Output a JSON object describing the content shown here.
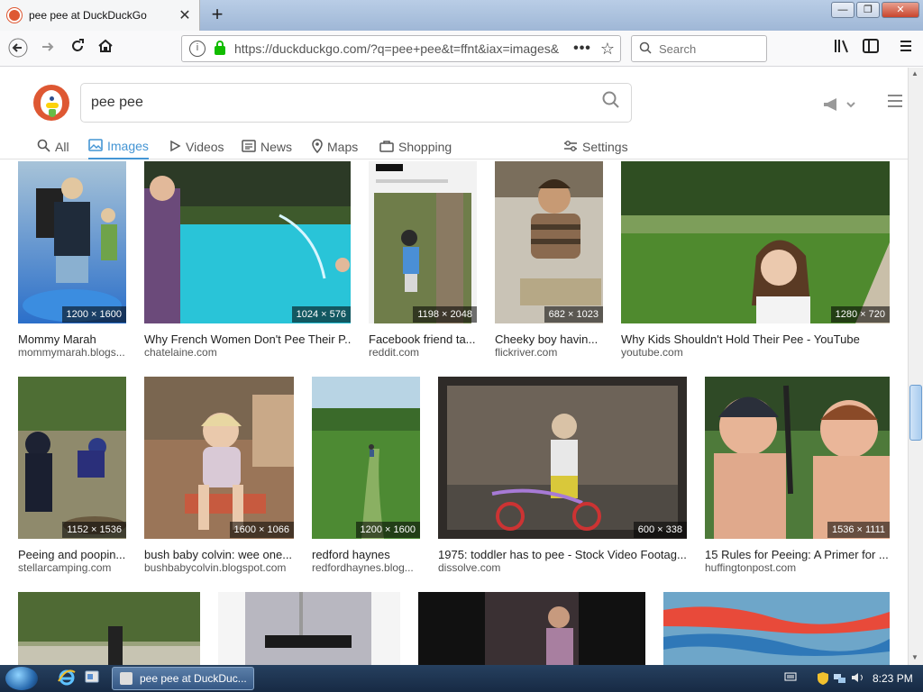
{
  "browser": {
    "tab_title": "pee pee at DuckDuckGo",
    "tab_close_glyph": "✕",
    "new_tab_glyph": "+",
    "window_buttons": [
      "—",
      "❐",
      "✕"
    ],
    "url": "https://duckduckgo.com/?q=pee+pee&t=ffnt&iax=images&",
    "url_more_glyph": "•••",
    "bookmark_glyph": "☆",
    "search_placeholder": "Search"
  },
  "ddg": {
    "query": "pee pee",
    "filters": [
      {
        "label": "All",
        "icon": "search-icon"
      },
      {
        "label": "Images",
        "icon": "image-icon"
      },
      {
        "label": "Videos",
        "icon": "play-icon"
      },
      {
        "label": "News",
        "icon": "newspaper-icon"
      },
      {
        "label": "Maps",
        "icon": "map-pin-icon"
      },
      {
        "label": "Shopping",
        "icon": "shopping-bag-icon"
      },
      {
        "label": "Settings",
        "icon": "sliders-icon"
      }
    ],
    "active_filter": "Images"
  },
  "results": [
    {
      "title": "Mommy Marah",
      "source": "mommymarah.blogs...",
      "dims": "1200 × 1600",
      "colors": [
        "#5a7fa8",
        "#2b6fc9"
      ]
    },
    {
      "title": "Why French Women Don't Pee Their P...",
      "source": "chatelaine.com",
      "dims": "1024 × 576",
      "colors": [
        "#3e5a2c",
        "#29c4d8"
      ]
    },
    {
      "title": "Facebook friend ta...",
      "source": "reddit.com",
      "dims": "1198 × 2048",
      "colors": [
        "#dcdcdc",
        "#6f7d4a"
      ]
    },
    {
      "title": "Cheeky boy havin...",
      "source": "flickriver.com",
      "dims": "682 × 1023",
      "colors": [
        "#c9c3b6",
        "#8a6a4f"
      ]
    },
    {
      "title": "Why Kids Shouldn't Hold Their Pee - YouTube",
      "source": "youtube.com",
      "dims": "1280 × 720",
      "colors": [
        "#6f8f4a",
        "#4f8a2e"
      ]
    },
    {
      "title": "Peeing and poopin...",
      "source": "stellarcamping.com",
      "dims": "1152 × 1536",
      "colors": [
        "#6b7a4e",
        "#8f8a6c"
      ]
    },
    {
      "title": "bush baby colvin: wee one...",
      "source": "bushbabycolvin.blogspot.com",
      "dims": "1600 × 1066",
      "colors": [
        "#9a7558",
        "#c75a3f"
      ]
    },
    {
      "title": "redford haynes",
      "source": "redfordhaynes.blog...",
      "dims": "1200 × 1600",
      "colors": [
        "#8fb6c9",
        "#4d8a33"
      ]
    },
    {
      "title": "1975: toddler has to pee - Stock Video Footag...",
      "source": "dissolve.com",
      "dims": "600 × 338",
      "colors": [
        "#2f2b28",
        "#6d6358"
      ]
    },
    {
      "title": "15 Rules for Peeing: A Primer for ...",
      "source": "huffingtonpost.com",
      "dims": "1536 × 1111",
      "colors": [
        "#4e7a3a",
        "#e0a98c"
      ]
    },
    {
      "title": "",
      "source": "",
      "dims": "",
      "colors": [
        "#4f6a34",
        "#9aa27c"
      ]
    },
    {
      "title": "",
      "source": "",
      "dims": "",
      "colors": [
        "#e6e4e2",
        "#b8b7c0"
      ]
    },
    {
      "title": "",
      "source": "",
      "dims": "",
      "colors": [
        "#111111",
        "#3a3033"
      ]
    },
    {
      "title": "",
      "source": "",
      "dims": "",
      "colors": [
        "#6ea6c9",
        "#2f78b8"
      ]
    }
  ],
  "taskbar": {
    "task_label": "pee pee at DuckDuc...",
    "clock": "8:23 PM"
  }
}
